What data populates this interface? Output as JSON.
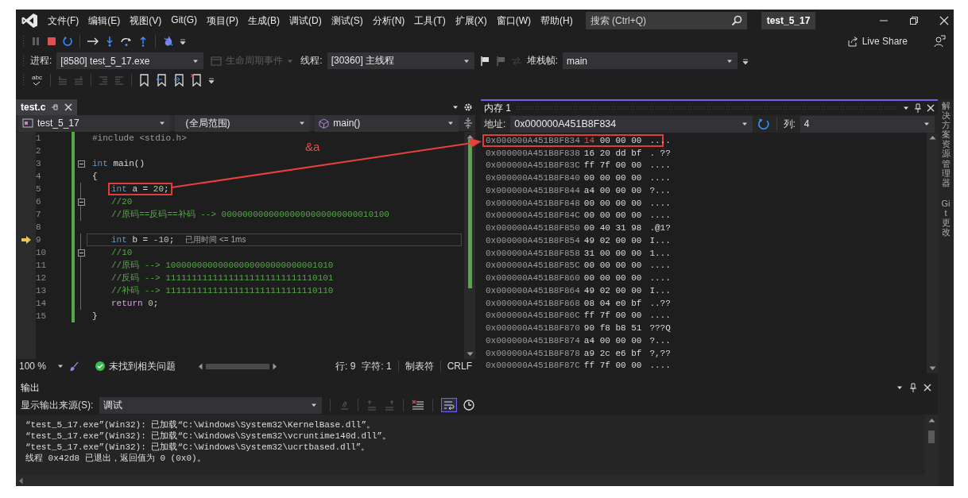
{
  "title_bar": {
    "menus": [
      "文件(F)",
      "编辑(E)",
      "视图(V)",
      "Git(G)",
      "项目(P)",
      "生成(B)",
      "调试(D)",
      "测试(S)",
      "分析(N)",
      "工具(T)",
      "扩展(X)",
      "窗口(W)",
      "帮助(H)"
    ],
    "search": {
      "placeholder": "搜索 (Ctrl+Q)"
    },
    "solution": "test_5_17"
  },
  "debug_toolbar": {
    "live_share": "Live Share"
  },
  "debug_location": {
    "process_label": "进程:",
    "process": "[8580] test_5_17.exe",
    "lifecycle": {
      "label": "生命周期事件",
      "disabled": true
    },
    "thread_label": "线程:",
    "thread": "[30360] 主线程",
    "stack_label": "堆栈帧:",
    "stack_frame": "main"
  },
  "text_toolbar": {
    "spell_check": "abc"
  },
  "editor": {
    "tabs": [
      {
        "label": "test.c",
        "selected": true
      }
    ],
    "project": "test_5_17",
    "scope": "(全局范围)",
    "member": "main()",
    "lines": [
      {
        "number": "1",
        "indented": false,
        "collapsible": false,
        "current": false,
        "highlighted": false,
        "segments": [
          {
            "kind": "preprocessor",
            "text": "#include <stdio.h>"
          }
        ]
      },
      {
        "number": "2",
        "collapsible": false,
        "current": false,
        "highlighted": false
      },
      {
        "number": "3",
        "indented": false,
        "collapsible": true,
        "current": false,
        "highlighted": false,
        "segments": [
          {
            "kind": "keyword",
            "text": "int"
          },
          {
            "kind": "plain",
            "text": " main()"
          }
        ]
      },
      {
        "number": "4",
        "indented": false,
        "collapsible": false,
        "current": false,
        "highlighted": false,
        "segments": [
          {
            "kind": "plain",
            "text": "{"
          }
        ]
      },
      {
        "number": "5",
        "indented": true,
        "collapsible": false,
        "current": false,
        "highlighted": true,
        "segments": [
          {
            "kind": "keyword",
            "text": "int"
          },
          {
            "kind": "plain",
            "text": " a = "
          },
          {
            "kind": "number",
            "text": "20"
          },
          {
            "kind": "plain",
            "text": ";"
          }
        ]
      },
      {
        "number": "6",
        "indented": true,
        "collapsible": true,
        "current": false,
        "highlighted": false,
        "segments": [
          {
            "kind": "comment",
            "text": "//20"
          }
        ]
      },
      {
        "number": "7",
        "indented": true,
        "collapsible": false,
        "current": false,
        "highlighted": false,
        "segments": [
          {
            "kind": "comment",
            "text": "//原码==反码==补码 --> 00000000000000000000000000010100"
          }
        ]
      },
      {
        "number": "8",
        "collapsible": false,
        "current": false,
        "highlighted": false
      },
      {
        "number": "9",
        "indented": true,
        "collapsible": false,
        "current": true,
        "highlighted": false,
        "hint": "已用时间 <= 1ms",
        "segments": [
          {
            "kind": "keyword",
            "text": "int"
          },
          {
            "kind": "plain",
            "text": " b = "
          },
          {
            "kind": "number",
            "text": "-10"
          },
          {
            "kind": "plain",
            "text": ";"
          }
        ]
      },
      {
        "number": "10",
        "indented": true,
        "collapsible": true,
        "current": false,
        "highlighted": false,
        "segments": [
          {
            "kind": "comment",
            "text": "//10"
          }
        ]
      },
      {
        "number": "11",
        "indented": true,
        "collapsible": false,
        "current": false,
        "highlighted": false,
        "segments": [
          {
            "kind": "comment",
            "text": "//原码 --> 10000000000000000000000000001010"
          }
        ]
      },
      {
        "number": "12",
        "indented": true,
        "collapsible": false,
        "current": false,
        "highlighted": false,
        "segments": [
          {
            "kind": "comment",
            "text": "//反码 --> 11111111111111111111111111110101"
          }
        ]
      },
      {
        "number": "13",
        "indented": true,
        "collapsible": false,
        "current": false,
        "highlighted": false,
        "segments": [
          {
            "kind": "comment",
            "text": "//补码 --> 11111111111111111111111111110110"
          }
        ]
      },
      {
        "number": "14",
        "indented": true,
        "collapsible": false,
        "current": false,
        "highlighted": false,
        "segments": [
          {
            "kind": "control",
            "text": "return"
          },
          {
            "kind": "number",
            "text": " 0"
          },
          {
            "kind": "plain",
            "text": ";"
          }
        ]
      },
      {
        "number": "15",
        "indented": false,
        "collapsible": false,
        "current": false,
        "highlighted": false,
        "segments": [
          {
            "kind": "plain",
            "text": "}"
          }
        ]
      }
    ],
    "status": {
      "zoom": "100 %",
      "issues": "未找到相关问题",
      "line": "行: 9",
      "char": "字符: 1",
      "indent": "制表符",
      "eol": "CRLF"
    }
  },
  "memory": {
    "title": "内存 1",
    "active": true,
    "address_label": "地址:",
    "address": "0x000000A451B8F834",
    "columns_label": "列:",
    "columns": "4",
    "rows": [
      {
        "address": "0x000000A451B8F834",
        "highlighted": true,
        "bytes": [
          {
            "value": "14",
            "changed": true
          },
          {
            "value": "00",
            "changed": false
          },
          {
            "value": "00",
            "changed": false
          },
          {
            "value": "00",
            "changed": false
          }
        ],
        "chars": "...."
      },
      {
        "address": "0x000000A451B8F838",
        "highlighted": false,
        "bytes": [
          {
            "value": "16",
            "changed": false
          },
          {
            "value": "20",
            "changed": false
          },
          {
            "value": "dd",
            "changed": false
          },
          {
            "value": "bf",
            "changed": false
          }
        ],
        "chars": ". ??"
      },
      {
        "address": "0x000000A451B8F83C",
        "highlighted": false,
        "bytes": [
          {
            "value": "ff",
            "changed": false
          },
          {
            "value": "7f",
            "changed": false
          },
          {
            "value": "00",
            "changed": false
          },
          {
            "value": "00",
            "changed": false
          }
        ],
        "chars": "...."
      },
      {
        "address": "0x000000A451B8F840",
        "highlighted": false,
        "bytes": [
          {
            "value": "00",
            "changed": false
          },
          {
            "value": "00",
            "changed": false
          },
          {
            "value": "00",
            "changed": false
          },
          {
            "value": "00",
            "changed": false
          }
        ],
        "chars": "...."
      },
      {
        "address": "0x000000A451B8F844",
        "highlighted": false,
        "bytes": [
          {
            "value": "a4",
            "changed": false
          },
          {
            "value": "00",
            "changed": false
          },
          {
            "value": "00",
            "changed": false
          },
          {
            "value": "00",
            "changed": false
          }
        ],
        "chars": "?..."
      },
      {
        "address": "0x000000A451B8F848",
        "highlighted": false,
        "bytes": [
          {
            "value": "00",
            "changed": false
          },
          {
            "value": "00",
            "changed": false
          },
          {
            "value": "00",
            "changed": false
          },
          {
            "value": "00",
            "changed": false
          }
        ],
        "chars": "...."
      },
      {
        "address": "0x000000A451B8F84C",
        "highlighted": false,
        "bytes": [
          {
            "value": "00",
            "changed": false
          },
          {
            "value": "00",
            "changed": false
          },
          {
            "value": "00",
            "changed": false
          },
          {
            "value": "00",
            "changed": false
          }
        ],
        "chars": "...."
      },
      {
        "address": "0x000000A451B8F850",
        "highlighted": false,
        "bytes": [
          {
            "value": "00",
            "changed": false
          },
          {
            "value": "40",
            "changed": false
          },
          {
            "value": "31",
            "changed": false
          },
          {
            "value": "98",
            "changed": false
          }
        ],
        "chars": ".@1?"
      },
      {
        "address": "0x000000A451B8F854",
        "highlighted": false,
        "bytes": [
          {
            "value": "49",
            "changed": false
          },
          {
            "value": "02",
            "changed": false
          },
          {
            "value": "00",
            "changed": false
          },
          {
            "value": "00",
            "changed": false
          }
        ],
        "chars": "I..."
      },
      {
        "address": "0x000000A451B8F858",
        "highlighted": false,
        "bytes": [
          {
            "value": "31",
            "changed": false
          },
          {
            "value": "00",
            "changed": false
          },
          {
            "value": "00",
            "changed": false
          },
          {
            "value": "00",
            "changed": false
          }
        ],
        "chars": "1..."
      },
      {
        "address": "0x000000A451B8F85C",
        "highlighted": false,
        "bytes": [
          {
            "value": "00",
            "changed": false
          },
          {
            "value": "00",
            "changed": false
          },
          {
            "value": "00",
            "changed": false
          },
          {
            "value": "00",
            "changed": false
          }
        ],
        "chars": "...."
      },
      {
        "address": "0x000000A451B8F860",
        "highlighted": false,
        "bytes": [
          {
            "value": "00",
            "changed": false
          },
          {
            "value": "00",
            "changed": false
          },
          {
            "value": "00",
            "changed": false
          },
          {
            "value": "00",
            "changed": false
          }
        ],
        "chars": "...."
      },
      {
        "address": "0x000000A451B8F864",
        "highlighted": false,
        "bytes": [
          {
            "value": "49",
            "changed": false
          },
          {
            "value": "02",
            "changed": false
          },
          {
            "value": "00",
            "changed": false
          },
          {
            "value": "00",
            "changed": false
          }
        ],
        "chars": "I..."
      },
      {
        "address": "0x000000A451B8F868",
        "highlighted": false,
        "bytes": [
          {
            "value": "08",
            "changed": false
          },
          {
            "value": "04",
            "changed": false
          },
          {
            "value": "e0",
            "changed": false
          },
          {
            "value": "bf",
            "changed": false
          }
        ],
        "chars": "..??"
      },
      {
        "address": "0x000000A451B8F86C",
        "highlighted": false,
        "bytes": [
          {
            "value": "ff",
            "changed": false
          },
          {
            "value": "7f",
            "changed": false
          },
          {
            "value": "00",
            "changed": false
          },
          {
            "value": "00",
            "changed": false
          }
        ],
        "chars": "...."
      },
      {
        "address": "0x000000A451B8F870",
        "highlighted": false,
        "bytes": [
          {
            "value": "90",
            "changed": false
          },
          {
            "value": "f8",
            "changed": false
          },
          {
            "value": "b8",
            "changed": false
          },
          {
            "value": "51",
            "changed": false
          }
        ],
        "chars": "???Q"
      },
      {
        "address": "0x000000A451B8F874",
        "highlighted": false,
        "bytes": [
          {
            "value": "a4",
            "changed": false
          },
          {
            "value": "00",
            "changed": false
          },
          {
            "value": "00",
            "changed": false
          },
          {
            "value": "00",
            "changed": false
          }
        ],
        "chars": "?..."
      },
      {
        "address": "0x000000A451B8F878",
        "highlighted": false,
        "bytes": [
          {
            "value": "a9",
            "changed": false
          },
          {
            "value": "2c",
            "changed": false
          },
          {
            "value": "e6",
            "changed": false
          },
          {
            "value": "bf",
            "changed": false
          }
        ],
        "chars": "?,??"
      },
      {
        "address": "0x000000A451B8F87C",
        "highlighted": false,
        "bytes": [
          {
            "value": "ff",
            "changed": false
          },
          {
            "value": "7f",
            "changed": false
          },
          {
            "value": "00",
            "changed": false
          },
          {
            "value": "00",
            "changed": false
          }
        ],
        "chars": "...."
      }
    ]
  },
  "side_tabs": [
    "解决方案资源管理器",
    "Git 更改"
  ],
  "output": {
    "title": "输出",
    "source_label": "显示输出来源(S):",
    "source": "调试",
    "word_wrap": true,
    "lines": [
      "“test_5_17.exe”(Win32): 已加载“C:\\Windows\\System32\\KernelBase.dll”。",
      "“test_5_17.exe”(Win32): 已加载“C:\\Windows\\System32\\vcruntime140d.dll”。",
      "“test_5_17.exe”(Win32): 已加载“C:\\Windows\\System32\\ucrtbased.dll”。",
      "线程 0x42d8 已退出，返回值为 0 (0x0)。"
    ]
  },
  "annotation": {
    "label": "&a"
  }
}
